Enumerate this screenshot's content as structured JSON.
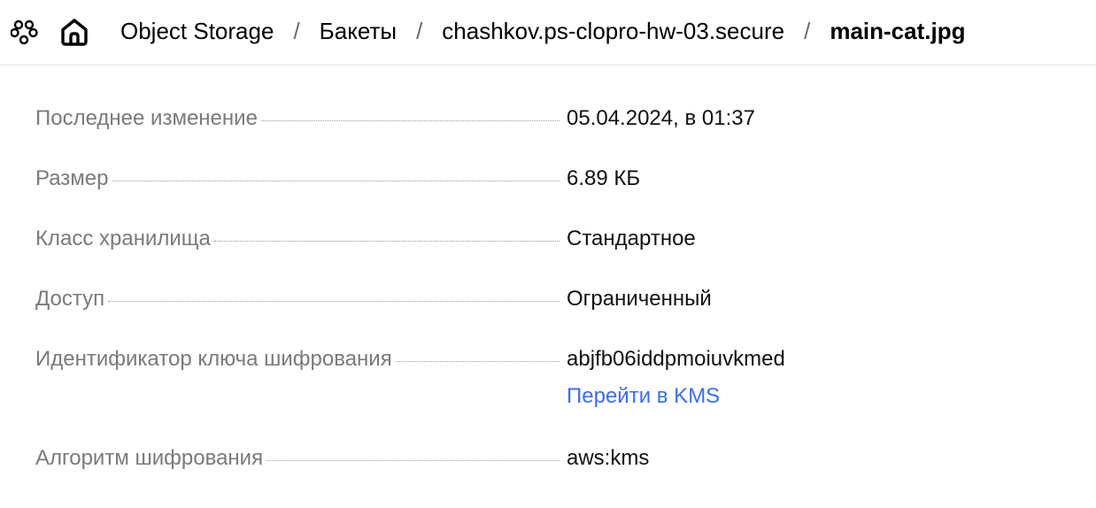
{
  "header": {
    "icons": {
      "services": "services-icon",
      "home": "home-icon"
    },
    "breadcrumbs": [
      {
        "label": "Object Storage"
      },
      {
        "label": "Бакеты"
      },
      {
        "label": "chashkov.ps-clopro-hw-03.secure"
      },
      {
        "label": "main-cat.jpg"
      }
    ],
    "separator": "/"
  },
  "details": {
    "rows": [
      {
        "label": "Последнее изменение",
        "value": "05.04.2024, в 01:37"
      },
      {
        "label": "Размер",
        "value": "6.89 КБ"
      },
      {
        "label": "Класс хранилища",
        "value": "Стандартное"
      },
      {
        "label": "Доступ",
        "value": "Ограниченный"
      },
      {
        "label": "Идентификатор ключа шифрования",
        "value": "abjfb06iddpmoiuvkmed"
      },
      {
        "label": "Алгоритм шифрования",
        "value": "aws:kms"
      }
    ],
    "kms_link": "Перейти в KMS"
  },
  "colors": {
    "label": "#7a7a7a",
    "value": "#111111",
    "link": "#3b6ee8",
    "divider": "#e5e5e5"
  }
}
